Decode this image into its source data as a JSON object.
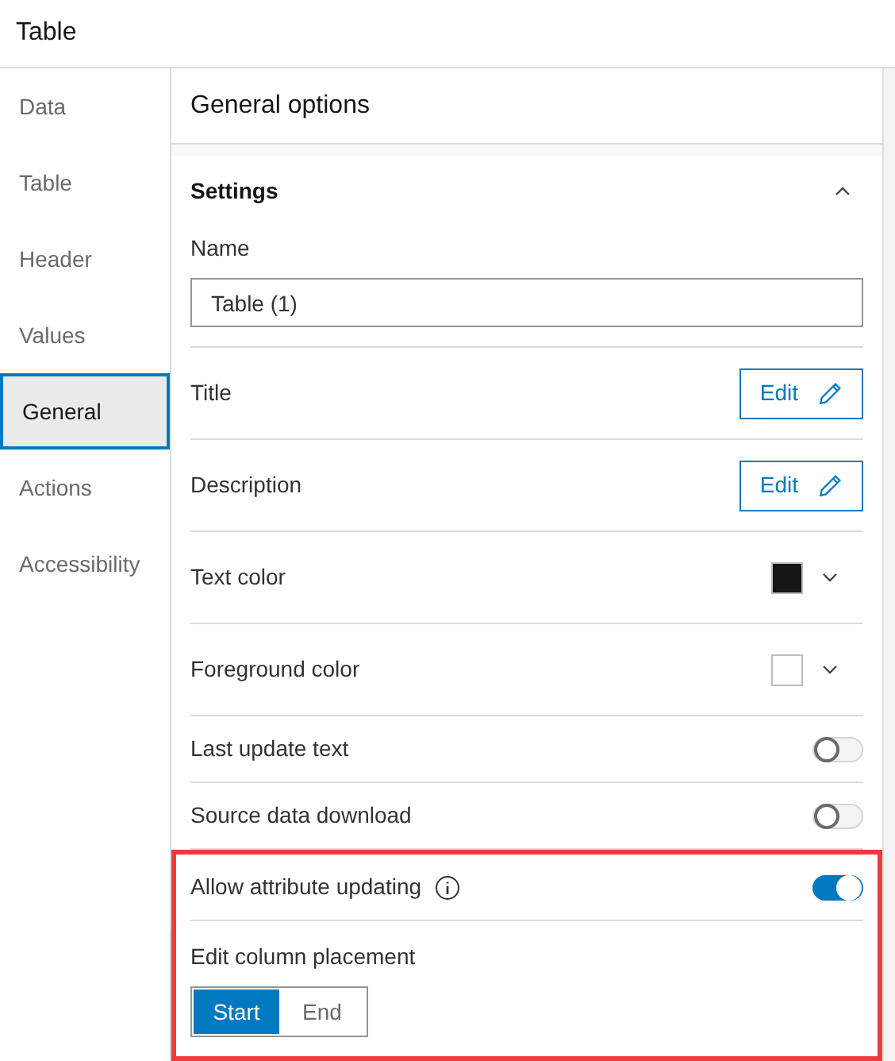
{
  "title": "Table",
  "sidebar": {
    "items": [
      {
        "label": "Data",
        "selected": false
      },
      {
        "label": "Table",
        "selected": false
      },
      {
        "label": "Header",
        "selected": false
      },
      {
        "label": "Values",
        "selected": false
      },
      {
        "label": "General",
        "selected": true
      },
      {
        "label": "Actions",
        "selected": false
      },
      {
        "label": "Accessibility",
        "selected": false
      }
    ]
  },
  "panel": {
    "title": "General options",
    "section": {
      "title": "Settings",
      "expanded": true,
      "name_field": {
        "label": "Name",
        "value": "Table (1)"
      },
      "rows": [
        {
          "kind": "edit",
          "label": "Title",
          "button": "Edit",
          "highlighted": false
        },
        {
          "kind": "edit",
          "label": "Description",
          "button": "Edit",
          "highlighted": false
        },
        {
          "kind": "color",
          "label": "Text color",
          "color": "#151515",
          "highlighted": false
        },
        {
          "kind": "color",
          "label": "Foreground color",
          "color": "#ffffff",
          "highlighted": false
        },
        {
          "kind": "toggle",
          "label": "Last update text",
          "on": false,
          "info": false,
          "highlighted": false
        },
        {
          "kind": "toggle",
          "label": "Source data download",
          "on": false,
          "info": false,
          "highlighted": false
        },
        {
          "kind": "toggle",
          "label": "Allow attribute updating",
          "on": true,
          "info": true,
          "highlighted": true
        },
        {
          "kind": "segmented",
          "label": "Edit column placement",
          "highlighted": true,
          "options": [
            {
              "label": "Start",
              "selected": true
            },
            {
              "label": "End",
              "selected": false
            }
          ]
        }
      ]
    }
  }
}
